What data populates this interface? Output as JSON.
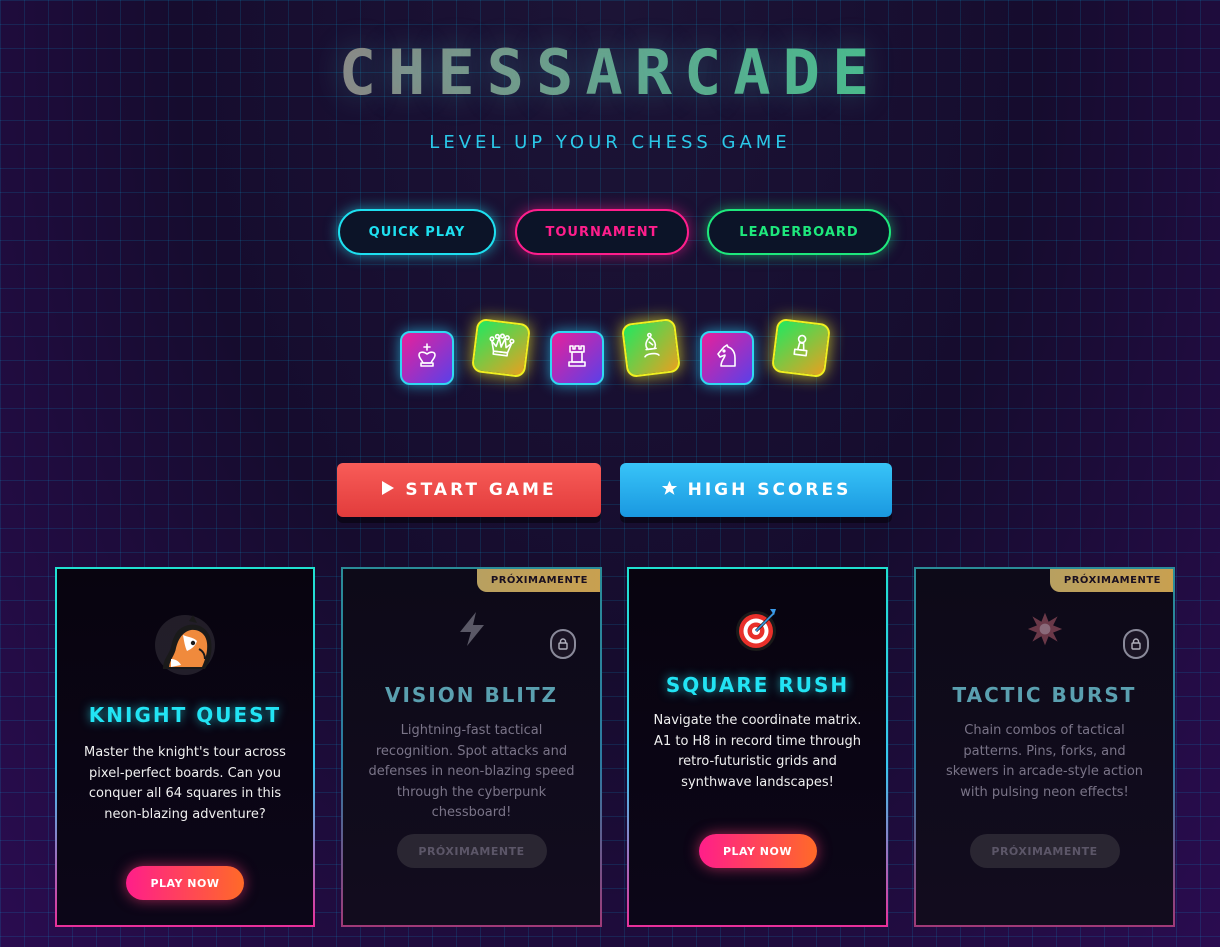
{
  "app": {
    "title": "CHESSARCADE",
    "subtitle": "LEVEL UP YOUR CHESS GAME"
  },
  "nav": {
    "items": [
      {
        "label": "QUICK PLAY",
        "color": "#1ee0f0"
      },
      {
        "label": "TOURNAMENT",
        "color": "#ff1e8c"
      },
      {
        "label": "LEADERBOARD",
        "color": "#1ee87c"
      }
    ]
  },
  "pieces": [
    {
      "icon": "king-icon"
    },
    {
      "icon": "queen-icon"
    },
    {
      "icon": "rook-icon"
    },
    {
      "icon": "bishop-icon"
    },
    {
      "icon": "knight-icon"
    },
    {
      "icon": "pawn-icon"
    }
  ],
  "actions": {
    "start": {
      "label": "START GAME",
      "icon": "play-icon",
      "color": "#f04c4a"
    },
    "scores": {
      "label": "HIGH SCORES",
      "icon": "star-icon",
      "color": "#2ab0ee"
    }
  },
  "modes": [
    {
      "title": "KNIGHT QUEST",
      "icon": "horse-icon",
      "description": "Master the knight's tour across pixel-perfect boards. Can you conquer all 64 squares in this neon-blazing adventure?",
      "button": "PLAY NOW",
      "locked": false
    },
    {
      "title": "VISION BLITZ",
      "icon": "lightning-icon",
      "badge": "PRÓXIMAMENTE",
      "description": "Lightning-fast tactical recognition. Spot attacks and defenses in neon-blazing speed through the cyberpunk chessboard!",
      "button": "PRÓXIMAMENTE",
      "locked": true
    },
    {
      "title": "SQUARE RUSH",
      "icon": "target-icon",
      "description": "Navigate the coordinate matrix. A1 to H8 in record time through retro-futuristic grids and synthwave landscapes!",
      "button": "PLAY NOW",
      "locked": false
    },
    {
      "title": "TACTIC BURST",
      "icon": "burst-icon",
      "badge": "PRÓXIMAMENTE",
      "description": "Chain combos of tactical patterns. Pins, forks, and skewers in arcade-style action with pulsing neon effects!",
      "button": "PRÓXIMAMENTE",
      "locked": true
    }
  ]
}
